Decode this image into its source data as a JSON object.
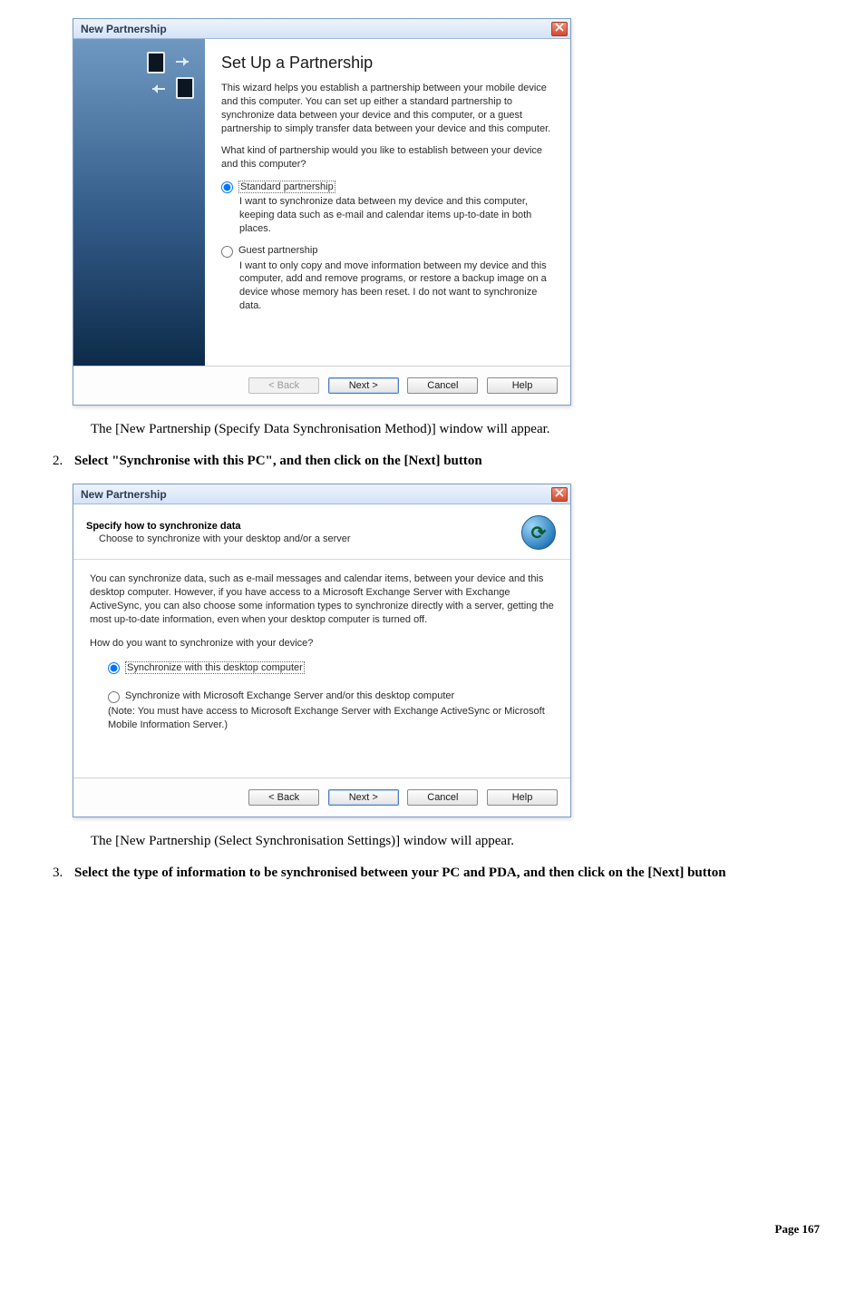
{
  "dialog1": {
    "title": "New Partnership",
    "heading": "Set Up a Partnership",
    "para1": "This wizard helps you establish a partnership between your mobile device and this computer. You can set up either a standard partnership to synchronize data between your device and this computer, or a guest partnership to simply transfer data between your device and this computer.",
    "para2": "What kind of partnership would you like to establish between your device and this computer?",
    "opt1_label": "Standard partnership",
    "opt1_desc": "I want to synchronize data between my device and this computer, keeping data such as e-mail and calendar items up-to-date in both places.",
    "opt2_label": "Guest partnership",
    "opt2_desc": "I want to only copy and move information between my device and this computer, add and remove programs, or restore a backup image on a device whose memory has been reset. I do not want to synchronize data.",
    "buttons": {
      "back": "< Back",
      "next": "Next >",
      "cancel": "Cancel",
      "help": "Help"
    }
  },
  "doc": {
    "after_d1": "The [New Partnership (Specify Data Synchronisation Method)] window will appear.",
    "step2_num": "2.",
    "step2_text": "Select \"Synchronise with this PC\", and then click on the [Next] button",
    "after_d2": "The [New Partnership (Select Synchronisation Settings)] window will appear.",
    "step3_num": "3.",
    "step3_text": "Select the type of information to be synchronised between your PC and PDA, and then click on the [Next] button",
    "page_footer": "Page 167"
  },
  "dialog2": {
    "title": "New Partnership",
    "hdr_title": "Specify how to synchronize data",
    "hdr_sub": "Choose to synchronize with your desktop and/or a server",
    "para1": "You can synchronize data, such as e-mail messages and calendar items, between your device and this desktop computer. However, if you have access to a Microsoft Exchange Server with Exchange ActiveSync, you can also choose some information types to synchronize directly with a server, getting the most up-to-date information, even when your desktop computer is turned off.",
    "para2": "How do you want to synchronize with your device?",
    "opt1_label": "Synchronize with this desktop computer",
    "opt2_label": "Synchronize with Microsoft Exchange Server and/or this desktop computer",
    "opt2_note": "(Note: You must have access to Microsoft Exchange Server with Exchange ActiveSync or Microsoft Mobile Information Server.)",
    "buttons": {
      "back": "< Back",
      "next": "Next >",
      "cancel": "Cancel",
      "help": "Help"
    }
  }
}
